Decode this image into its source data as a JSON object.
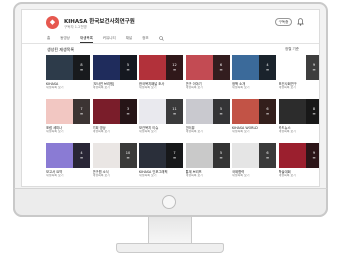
{
  "channel": {
    "logo_glyph": "◆",
    "name": "KIHASA 한국보건사회연구원",
    "subtitle": "구독자 1.2천명",
    "subscribe_label": "구독중",
    "accent": "#e6584f"
  },
  "tabs": [
    {
      "label": "홈"
    },
    {
      "label": "동영상"
    },
    {
      "label": "재생목록"
    },
    {
      "label": "커뮤니티"
    },
    {
      "label": "채널"
    },
    {
      "label": "정보"
    }
  ],
  "active_tab_index": 2,
  "section": {
    "title": "생성된 재생목록",
    "sort_label": "정렬 기준"
  },
  "videos": [
    {
      "title": "KIHASA",
      "link": "재생목록 보기",
      "count": "8",
      "color": "#2d3b4a"
    },
    {
      "title": "[보사연 브리핑]",
      "link": "재생목록 보기",
      "count": "5",
      "color": "#1f2c5c"
    },
    {
      "title": "한국복지패널 조사",
      "link": "재생목록 보기",
      "count": "12",
      "color": "#b2313a"
    },
    {
      "title": "연구 이야기",
      "link": "재생목록 보기",
      "count": "6",
      "color": "#c34b53"
    },
    {
      "title": "정책 소개",
      "link": "재생목록 보기",
      "count": "4",
      "color": "#3b6a9a"
    },
    {
      "title": "보건사회연구",
      "link": "재생목록 보기",
      "count": "9",
      "color": "#ffffff"
    },
    {
      "title": "포럼 세미나",
      "link": "재생목록 보기",
      "count": "7",
      "color": "#f2c7c2"
    },
    {
      "title": "기획 영상",
      "link": "재생목록 보기",
      "count": "3",
      "color": "#7a1d2a"
    },
    {
      "title": "보건복지 이슈",
      "link": "재생목록 보기",
      "count": "11",
      "color": "#e9e9ee"
    },
    {
      "title": "인터뷰",
      "link": "재생목록 보기",
      "count": "5",
      "color": "#c9c9cf"
    },
    {
      "title": "KIHASA WORLD",
      "link": "재생목록 보기",
      "count": "6",
      "color": "#c25346"
    },
    {
      "title": "카드뉴스",
      "link": "재생목록 보기",
      "count": "8",
      "color": "#2c2c2c"
    },
    {
      "title": "보고서 요약",
      "link": "재생목록 보기",
      "count": "4",
      "color": "#8a7bd4"
    },
    {
      "title": "연구원 소식",
      "link": "재생목록 보기",
      "count": "10",
      "color": "#eae6e4"
    },
    {
      "title": "KIHASA 인포그래픽",
      "link": "재생목록 보기",
      "count": "7",
      "color": "#2a2f3a"
    },
    {
      "title": "통계 브리프",
      "link": "재생목록 보기",
      "count": "5",
      "color": "#c9c9c9"
    },
    {
      "title": "국제협력",
      "link": "재생목록 보기",
      "count": "6",
      "color": "#e5e5e5"
    },
    {
      "title": "학술대회",
      "link": "재생목록 보기",
      "count": "9",
      "color": "#9b1f2e"
    },
    {
      "title": "청년 정책",
      "link": "재생목록 보기",
      "count": "4",
      "color": "#ffffff"
    },
    {
      "title": "개원 기념 영상",
      "link": "재생목록 보기",
      "count": "3",
      "color": "#b33a2a"
    },
    {
      "title": "기타 동영상",
      "link": "재생목록 보기",
      "count": "12",
      "color": "#d65a3e"
    }
  ]
}
